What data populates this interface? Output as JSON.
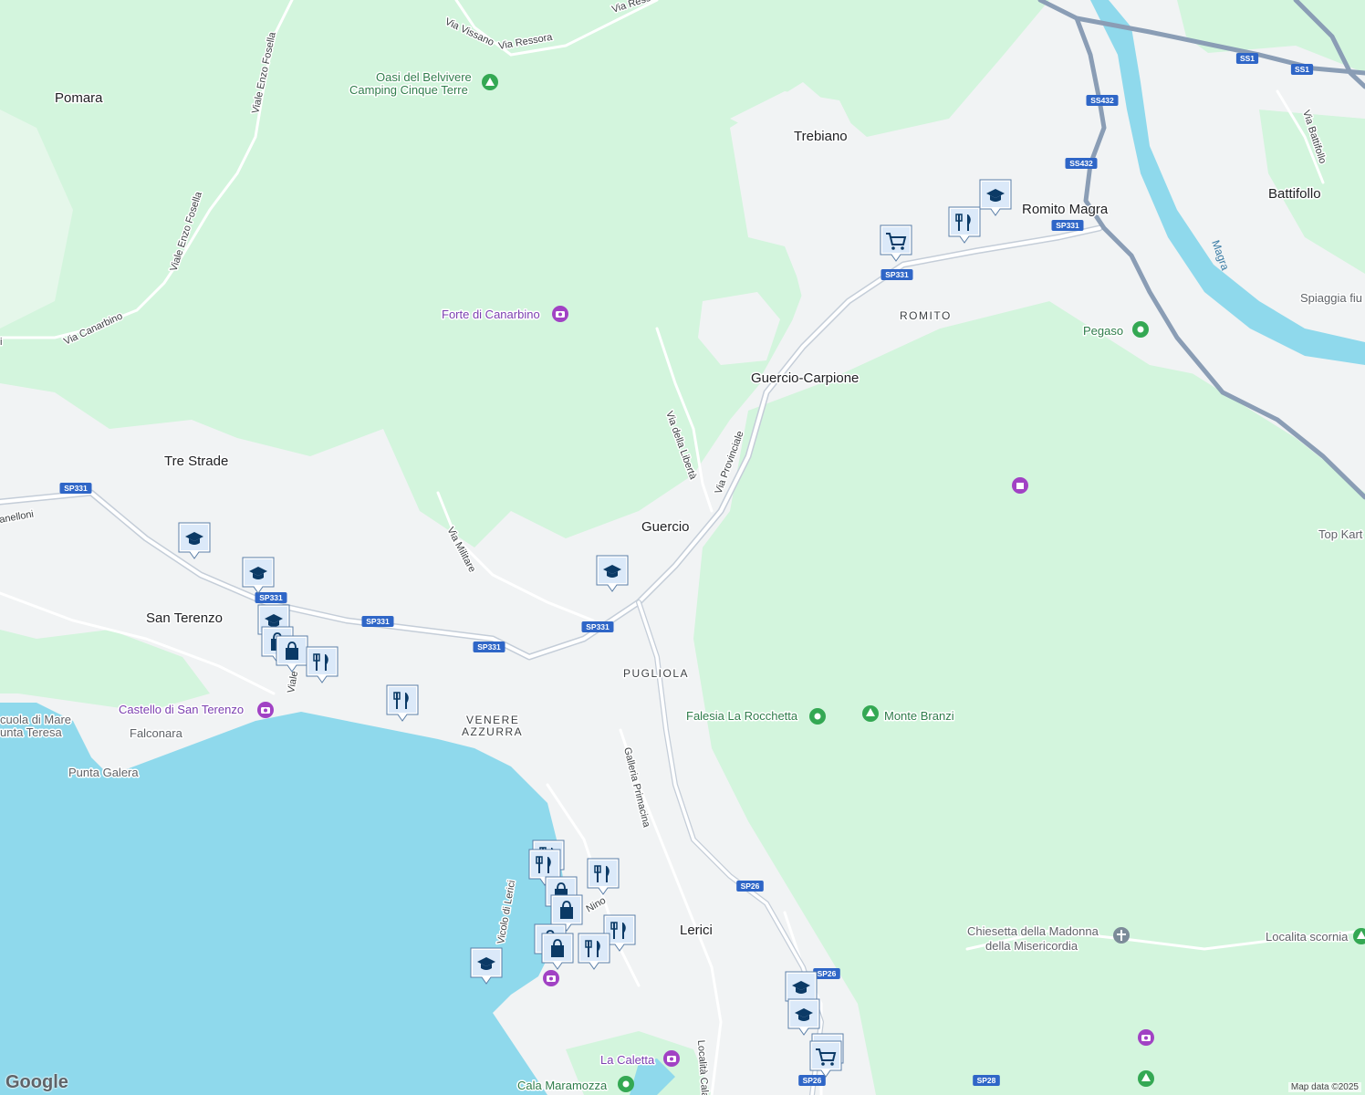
{
  "map": {
    "labels": {
      "places": {
        "pomara": "Pomara",
        "trebiano": "Trebiano",
        "romito_magra": "Romito Magra",
        "battifollo": "Battifollo",
        "guercio_carpione": "Guercio-Carpione",
        "tre_strade": "Tre Strade",
        "guercio": "Guercio",
        "san_terenzo": "San Terenzo",
        "lerici": "Lerici",
        "falconara": "Falconara",
        "punta_galera": "Punta Galera",
        "punta_teresa": "unta Teresa",
        "scuola_mare": "cuola di Mare",
        "top_kart": "Top Kart",
        "spiaggia": "Spiaggia fiu",
        "localita_scornia": "Localita scornia",
        "chiesetta_1": "Chiesetta della Madonna",
        "chiesetta_2": "della Misericordia"
      },
      "districts": {
        "romito": "ROMITO",
        "pugliola": "PUGLIOLA",
        "venere_1": "VENERE",
        "venere_2": "AZZURRA"
      },
      "roads": {
        "via_vissano": "Via Vissano",
        "via_ressora": "Via Ressora",
        "via_ressora_2": "Via Resso",
        "viale_fosella_1": "Viale Enzo Fosella",
        "viale_fosella_2": "Viale Enzo Fosella",
        "via_canarbino": "Via Canarbino",
        "via_liberta": "Via della Libertà",
        "via_provinciale": "Via Provinciale",
        "via_militare": "Via Militare",
        "galleria": "Galleria Primacina",
        "via_battifollo": "Via Battifollo",
        "localita_cala": "Località Cala",
        "via_nino": "Nino",
        "viale": "Viale",
        "vicolo": "Vicolo di Lerici",
        "cannelloni": "anelloni",
        "left_i": "i"
      },
      "pois": {
        "oasi_1": "Oasi del Belvivere",
        "oasi_2": "Camping Cinque Terre",
        "forte": "Forte di Canarbino",
        "pegaso": "Pegaso",
        "castello": "Castello di San Terenzo",
        "falesia": "Falesia La Rocchetta",
        "monte_branzi": "Monte Branzi",
        "la_caletta": "La Caletta",
        "cala_maramozza": "Cala Maramozza"
      },
      "water": {
        "magra": "Magra"
      }
    },
    "shields": [
      "SS1",
      "SS1",
      "SS432",
      "SS432",
      "SP331",
      "SP331",
      "SP331",
      "SP331",
      "SP331",
      "SP331",
      "SP331",
      "SP26",
      "SP26",
      "SP26",
      "SP28"
    ],
    "marker_icons": [
      "school-icon",
      "restaurant-icon",
      "shopping-cart-icon",
      "shopping-bag-icon",
      "camera-icon",
      "tree-icon",
      "camping-icon",
      "museum-icon",
      "church-icon"
    ],
    "colors": {
      "land": "#f1f3f4",
      "park": "#d3f5dd",
      "sea": "#8fd9ec",
      "river": "#8fd9ec",
      "highway": "#8a9db5",
      "road": "#ffffff",
      "marker_fill": "#dbe9f9",
      "marker_icon": "#0b3a66",
      "poi_purple": "#a142c4",
      "poi_green": "#34a853",
      "shield": "#2f66c7"
    },
    "attribution": "Map data ©2025",
    "logo": "Google"
  }
}
